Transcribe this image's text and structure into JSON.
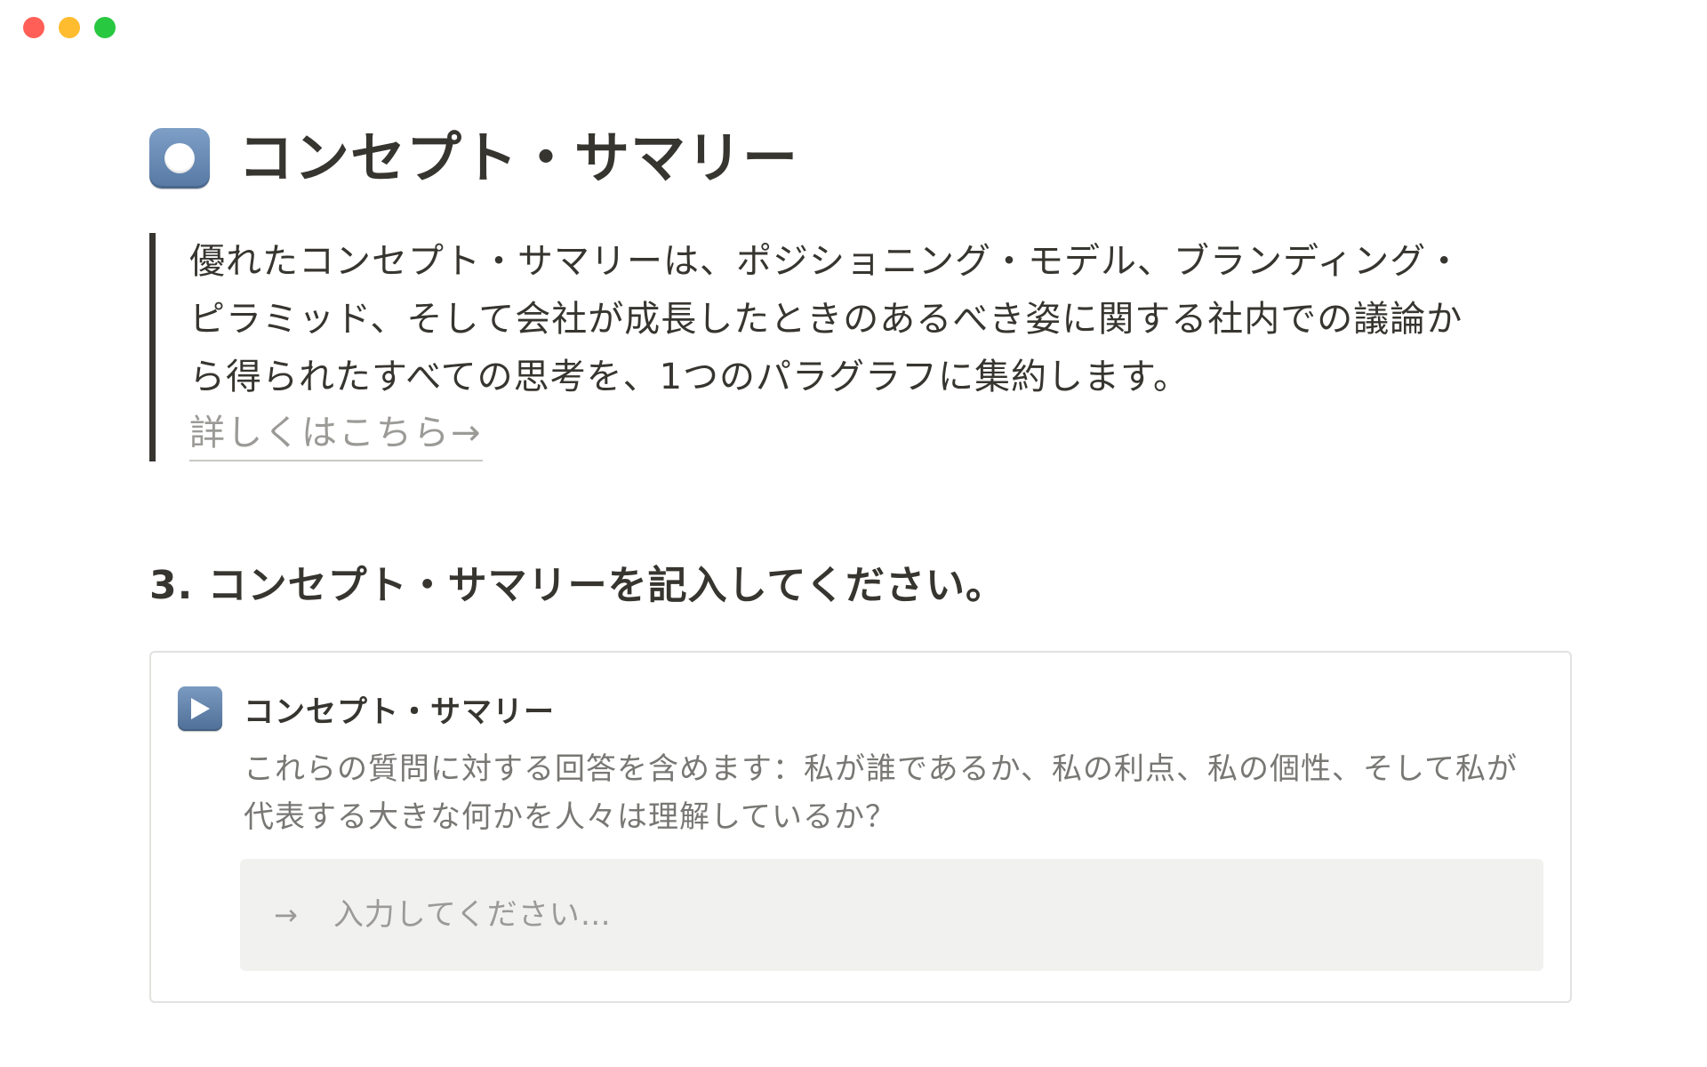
{
  "window": {
    "controls": [
      "close",
      "minimize",
      "maximize"
    ]
  },
  "page": {
    "icon": "record-button-icon",
    "title": "コンセプト・サマリー"
  },
  "quote": {
    "text": "優れたコンセプト・サマリーは、ポジショニング・モデル、ブランディング・ピラミッド、そして会社が成長したときのあるべき姿に関する社内での議論から得られたすべての思考を、1つのパラグラフに集約します。",
    "link_label": "詳しくはこちら→"
  },
  "section": {
    "heading": "3. コンセプト・サマリーを記入してください。"
  },
  "callout": {
    "icon": "play-button-icon",
    "title": "コンセプト・サマリー",
    "description": "これらの質問に対する回答を含めます：私が誰であるか、私の利点、私の個性、そして私が代表する大きな何かを人々は理解しているか？",
    "input": {
      "arrow": "→",
      "placeholder": "入力してください…",
      "value": ""
    }
  },
  "colors": {
    "text": "#37352f",
    "muted": "#787774",
    "placeholder": "#9b9a97",
    "input_bg": "#f1f1ef",
    "border": "#e3e2e0"
  }
}
